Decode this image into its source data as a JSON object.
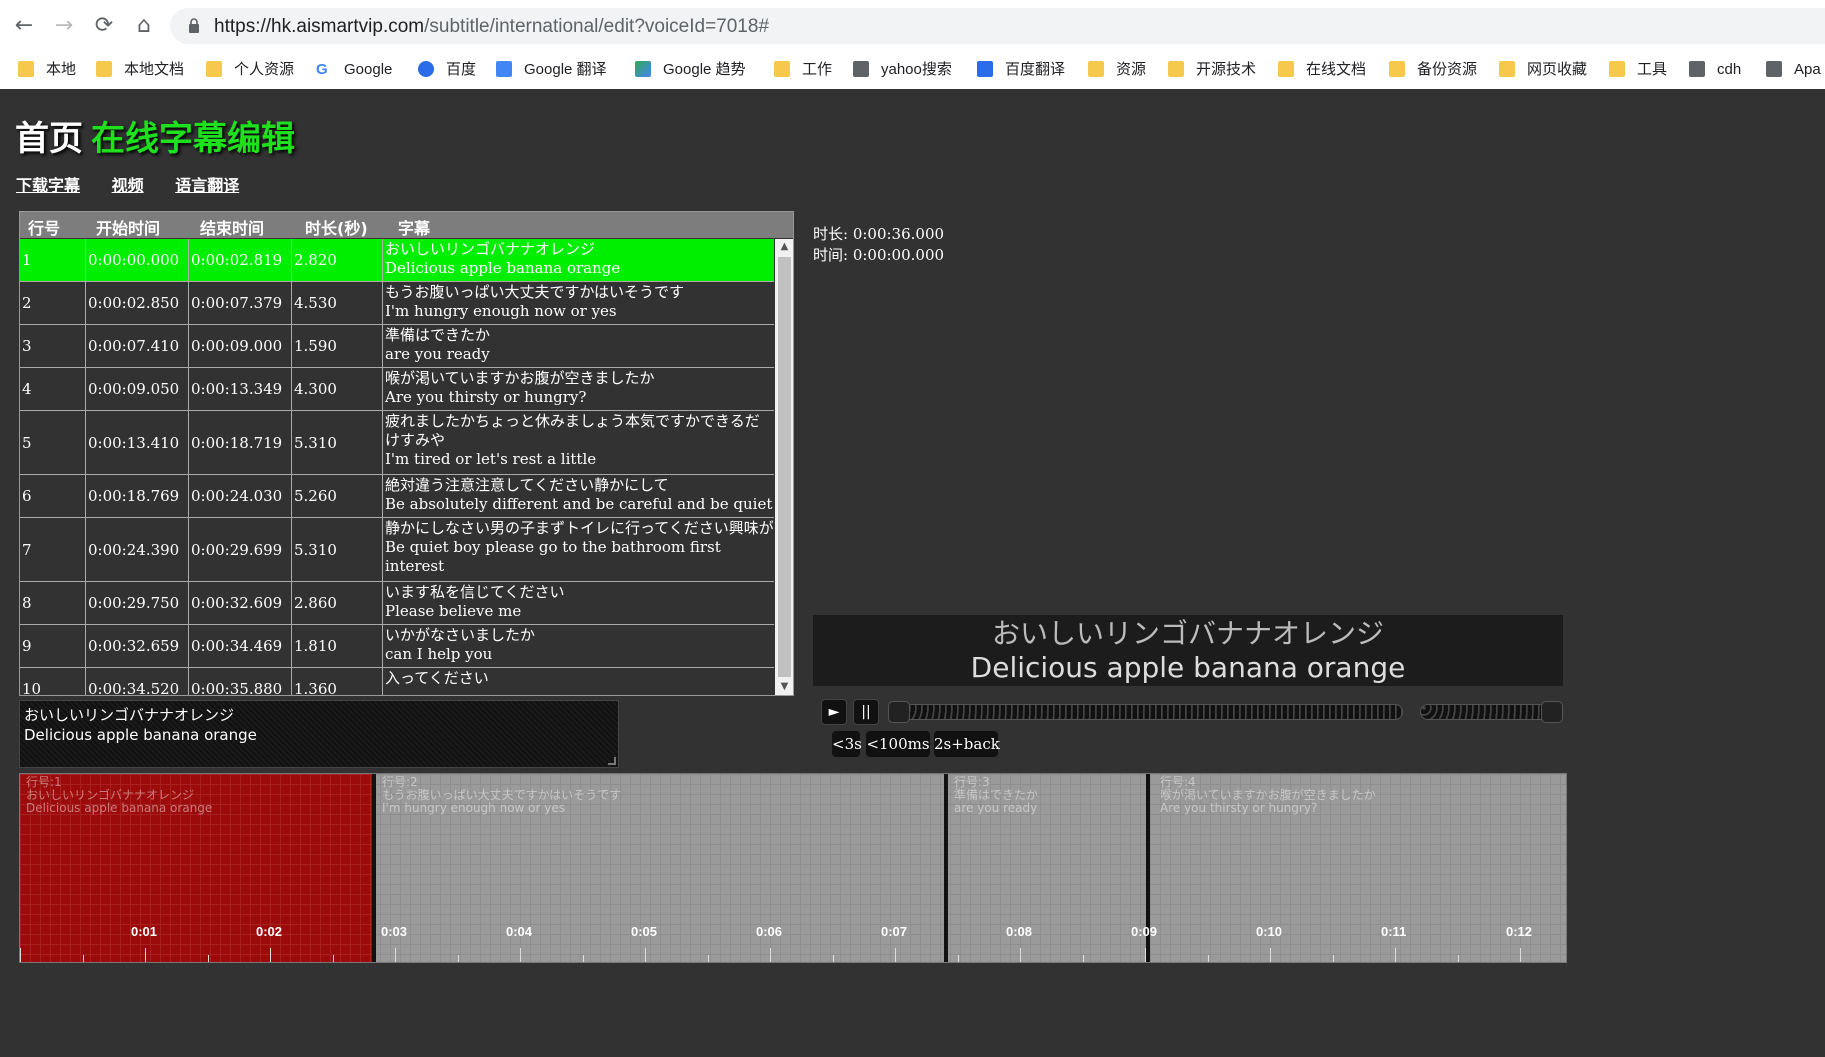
{
  "browser": {
    "url_host": "https://hk.aismartvip.com",
    "url_path": "/subtitle/international/edit?voiceId=7018#",
    "bookmarks": [
      "本地",
      "本地文档",
      "个人资源",
      "Google",
      "百度",
      "Google 翻译",
      "Google 趋势",
      "工作",
      "yahoo搜索",
      "百度翻译",
      "资源",
      "开源技术",
      "在线文档",
      "备份资源",
      "网页收藏",
      "工具",
      "cdh",
      "Apa"
    ]
  },
  "header": {
    "home": "首页",
    "title": "在线字幕编辑",
    "nav": [
      "下载字幕",
      "视频",
      "语言翻译"
    ]
  },
  "table": {
    "columns": [
      "行号",
      "开始时间",
      "结束时间",
      "时长(秒)",
      "字幕"
    ],
    "rows": [
      {
        "no": "1",
        "start": "0:00:00.000",
        "end": "0:00:02.819",
        "dur": "2.820",
        "jp": "おいしいリンゴバナナオレンジ",
        "en": "Delicious apple banana orange"
      },
      {
        "no": "2",
        "start": "0:00:02.850",
        "end": "0:00:07.379",
        "dur": "4.530",
        "jp": "もうお腹いっぱい大丈夫ですかはいそうです",
        "en": "I'm hungry enough now or yes"
      },
      {
        "no": "3",
        "start": "0:00:07.410",
        "end": "0:00:09.000",
        "dur": "1.590",
        "jp": "準備はできたか",
        "en": "are you ready"
      },
      {
        "no": "4",
        "start": "0:00:09.050",
        "end": "0:00:13.349",
        "dur": "4.300",
        "jp": "喉が渇いていますかお腹が空きましたか",
        "en": "Are you thirsty or hungry?"
      },
      {
        "no": "5",
        "start": "0:00:13.410",
        "end": "0:00:18.719",
        "dur": "5.310",
        "jp": "疲れましたかちょっと休みましょう本気ですかできるだけすみや",
        "en": "I'm tired or let's rest a little"
      },
      {
        "no": "6",
        "start": "0:00:18.769",
        "end": "0:00:24.030",
        "dur": "5.260",
        "jp": "絶対違う注意注意してください静かにして",
        "en": "Be absolutely different and be careful and be quiet"
      },
      {
        "no": "7",
        "start": "0:00:24.390",
        "end": "0:00:29.699",
        "dur": "5.310",
        "jp": "静かにしなさい男の子まずトイレに行ってください興味が",
        "en": "Be quiet boy please go to the bathroom first interest"
      },
      {
        "no": "8",
        "start": "0:00:29.750",
        "end": "0:00:32.609",
        "dur": "2.860",
        "jp": "います私を信じてください",
        "en": "Please believe me"
      },
      {
        "no": "9",
        "start": "0:00:32.659",
        "end": "0:00:34.469",
        "dur": "1.810",
        "jp": "いかがなさいましたか",
        "en": "can I help you"
      },
      {
        "no": "10",
        "start": "0:00:34.520",
        "end": "0:00:35.880",
        "dur": "1.360",
        "jp": "入ってください",
        "en": ""
      }
    ]
  },
  "editor": {
    "line1": "おいしいリンゴバナナオレンジ",
    "line2": "Delicious apple banana orange"
  },
  "player": {
    "duration": "时长: 0:00:36.000",
    "time": "时间: 0:00:00.000",
    "sub_line1": "おいしいリンゴバナナオレンジ",
    "sub_line2": "Delicious apple banana orange",
    "play_glyph": "►",
    "pause_glyph": "||",
    "step_buttons": [
      "<3s",
      "<100ms",
      "2s+back"
    ],
    "progress": 0,
    "volume": 1.0
  },
  "timeline": {
    "segments": [
      {
        "label": "行号:1",
        "jp": "おいしいリンゴバナナオレンジ",
        "en": "Delicious apple banana orange",
        "active": true
      },
      {
        "label": "行号:2",
        "jp": "もうお腹いっぱい大丈夫ですかはいそうです",
        "en": "I'm hungry enough now or yes",
        "active": false
      },
      {
        "label": "行号:3",
        "jp": "準備はできたか",
        "en": "are you ready",
        "active": false
      },
      {
        "label": "行号:4",
        "jp": "喉が渇いていますかお腹が空きましたか",
        "en": "Are you thirsty or hungry?",
        "active": false
      }
    ],
    "ticks": [
      "0:01",
      "0:02",
      "0:03",
      "0:04",
      "0:05",
      "0:06",
      "0:07",
      "0:08",
      "0:09",
      "0:10",
      "0:11",
      "0:12"
    ]
  },
  "colors": {
    "active_row": "#00ee00",
    "title_green": "#1ee11e",
    "active_segment": "#9b0b0b"
  }
}
